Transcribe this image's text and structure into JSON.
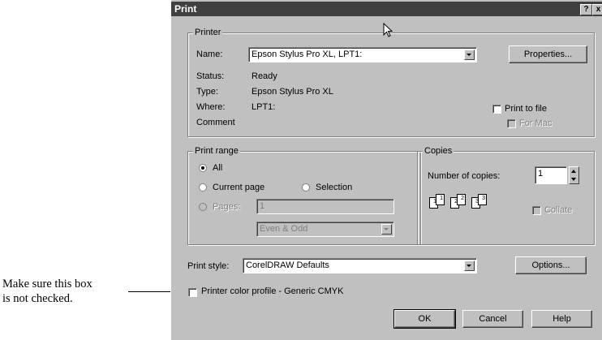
{
  "annotation": {
    "line1": "Make sure this box",
    "line2": "is not checked."
  },
  "dialog": {
    "title": "Print",
    "help_btn": "?",
    "close_btn": "x"
  },
  "printer": {
    "legend": "Printer",
    "name_label": "Name:",
    "name_value": "Epson Stylus Pro XL, LPT1:",
    "properties_btn": "Properties...",
    "status_label": "Status:",
    "status_value": "Ready",
    "type_label": "Type:",
    "type_value": "Epson Stylus Pro XL",
    "where_label": "Where:",
    "where_value": "LPT1:",
    "comment_label": "Comment",
    "print_to_file": "Print to file",
    "for_mac": "For Mac"
  },
  "print_range": {
    "legend": "Print range",
    "all": "All",
    "current_page": "Current page",
    "selection": "Selection",
    "pages": "Pages:",
    "pages_value": "1",
    "even_odd": "Even & Odd"
  },
  "copies": {
    "legend": "Copies",
    "number_label": "Number of copies:",
    "number_value": "1",
    "collate": "Collate",
    "pages": [
      "1",
      "1",
      "2",
      "2",
      "3",
      "3"
    ]
  },
  "print_style": {
    "label": "Print style:",
    "value": "CorelDRAW Defaults",
    "options_btn": "Options..."
  },
  "color_profile": "Printer color profile - Generic CMYK",
  "buttons": {
    "ok": "OK",
    "cancel": "Cancel",
    "help": "Help"
  }
}
